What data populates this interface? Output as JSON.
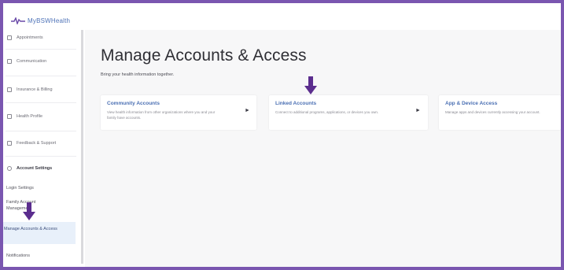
{
  "app": {
    "logo_text": "MyBSWHealth"
  },
  "sidebar": {
    "items": [
      {
        "label": "Appointments",
        "icon": "calendar-icon"
      },
      {
        "label": "Communication",
        "icon": "message-icon"
      },
      {
        "label": "Insurance & Billing",
        "icon": "billing-icon"
      },
      {
        "label": "Health Profile",
        "icon": "profile-icon"
      },
      {
        "label": "Feedback & Support",
        "icon": "support-icon"
      }
    ],
    "section": {
      "label": "Account Settings",
      "icon": "gear-icon"
    },
    "sub_items": [
      {
        "label": "Login Settings"
      },
      {
        "label": "Family Account Management"
      }
    ],
    "active_item": {
      "label": "Manage Accounts & Access"
    },
    "last_item": {
      "label": "Notifications"
    }
  },
  "main": {
    "title": "Manage Accounts & Access",
    "subtitle": "Bring your health information together.",
    "cards": [
      {
        "title": "Community Accounts",
        "description": "View health information from other organizations where you and your family have accounts."
      },
      {
        "title": "Linked Accounts",
        "description": "Connect to additional programs, applications, or devices you own."
      },
      {
        "title": "App & Device Access",
        "description": "Manage apps and devices currently accessing your account."
      }
    ]
  },
  "colors": {
    "accent": "#4a6fb3",
    "frame": "#7a56b0",
    "arrow": "#5b2d8e"
  }
}
